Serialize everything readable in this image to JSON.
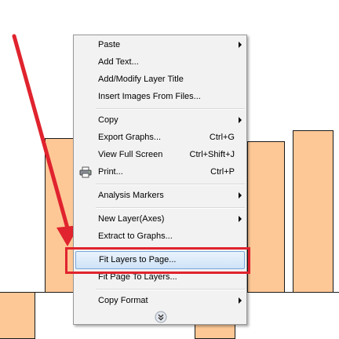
{
  "menu": {
    "items": [
      {
        "label": "Paste",
        "shortcut": "",
        "submenu": true
      },
      {
        "label": "Add Text...",
        "shortcut": "",
        "submenu": false
      },
      {
        "label": "Add/Modify Layer Title",
        "shortcut": "",
        "submenu": false
      },
      {
        "label": "Insert Images From Files...",
        "shortcut": "",
        "submenu": false
      },
      {
        "label": "Copy",
        "shortcut": "",
        "submenu": true
      },
      {
        "label": "Export Graphs...",
        "shortcut": "Ctrl+G",
        "submenu": false
      },
      {
        "label": "View Full Screen",
        "shortcut": "Ctrl+Shift+J",
        "submenu": false
      },
      {
        "label": "Print...",
        "shortcut": "Ctrl+P",
        "submenu": false,
        "icon": "printer-icon"
      },
      {
        "label": "Analysis Markers",
        "shortcut": "",
        "submenu": true
      },
      {
        "label": "New Layer(Axes)",
        "shortcut": "",
        "submenu": true
      },
      {
        "label": "Extract to Graphs...",
        "shortcut": "",
        "submenu": false
      },
      {
        "label": "Fit Layers to Page...",
        "shortcut": "",
        "submenu": false,
        "highlighted": true
      },
      {
        "label": "Fit Page To Layers...",
        "shortcut": "",
        "submenu": false
      },
      {
        "label": "Copy Format",
        "shortcut": "",
        "submenu": true
      }
    ],
    "expand_icon": "double-chevron-down-icon"
  },
  "annotation": {
    "arrow_color": "#e0232e",
    "box_color": "#e0232e"
  },
  "colors": {
    "bar_fill": "#fdc896",
    "highlight": "#cfe3f8"
  }
}
